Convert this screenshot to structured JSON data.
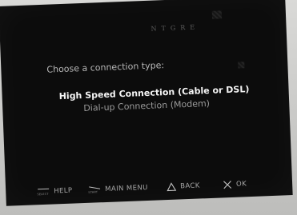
{
  "screen": {
    "brand": "NTGRE",
    "prompt": "Choose a connection type:",
    "options": [
      {
        "label": "High Speed Connection (Cable or DSL)",
        "state": "selected"
      },
      {
        "label": "Dial-up Connection (Modem)",
        "state": "unselected"
      }
    ]
  },
  "controls": {
    "help": {
      "button_label": "SELECT",
      "label": "HELP",
      "icon": "select-button-icon"
    },
    "menu": {
      "button_label": "START",
      "label": "MAIN MENU",
      "icon": "start-button-icon"
    },
    "back": {
      "label": "BACK",
      "icon": "triangle-icon"
    },
    "ok": {
      "label": "OK",
      "icon": "cross-icon"
    }
  },
  "colors": {
    "background": "#0c0c0c",
    "selected_text": "#f4f4f4",
    "unselected_text": "#9a9a9a"
  }
}
